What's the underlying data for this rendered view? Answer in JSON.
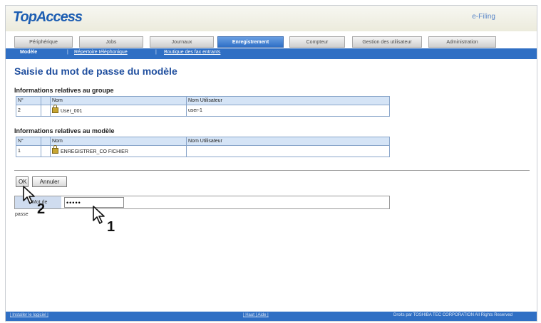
{
  "header": {
    "logo": "TopAccess",
    "eflink": "e-Filing"
  },
  "tabs": [
    {
      "label": "Périphérique"
    },
    {
      "label": "Jobs"
    },
    {
      "label": "Journaux"
    },
    {
      "label": "Enregistrement",
      "active": true
    },
    {
      "label": "Compteur"
    },
    {
      "label": "Gestion des utilisateur"
    },
    {
      "label": "Administration"
    }
  ],
  "subnav": [
    {
      "label": "Modèle"
    },
    {
      "label": "Répertoire téléphonique"
    },
    {
      "label": "Boutique des fax entrants"
    }
  ],
  "page_title": "Saisie du mot de passe du modèle",
  "group_section": {
    "title": "Informations relatives au groupe",
    "headers": [
      "N°",
      "",
      "Nom",
      "Nom Utilisateur"
    ],
    "row": {
      "num": "2",
      "name": "User_001",
      "user": "user-1"
    }
  },
  "template_section": {
    "title": "Informations relatives au modèle",
    "headers": [
      "N°",
      "",
      "Nom",
      "Nom Utilisateur"
    ],
    "row": {
      "num": "1",
      "name": "ENREGISTRER_CO FICHIER",
      "user": ""
    }
  },
  "buttons": {
    "ok": "OK",
    "cancel": "Annuler"
  },
  "password": {
    "label": "Mot de passe",
    "value": "•••••"
  },
  "footer": {
    "left": "| Installer le logiciel |",
    "center": "| Haut | Aide |",
    "right": "Droits par TOSHIBA TEC CORPORATION All Rights Reserved"
  },
  "callouts": {
    "first": "1",
    "second": "2"
  }
}
